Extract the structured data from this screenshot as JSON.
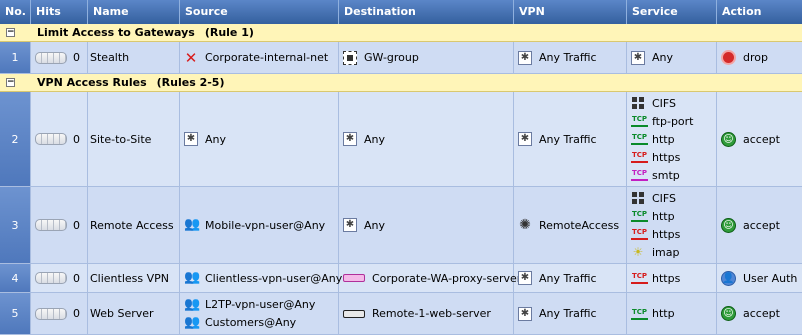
{
  "headers": {
    "no": "No.",
    "hits": "Hits",
    "name": "Name",
    "source": "Source",
    "destination": "Destination",
    "vpn": "VPN",
    "service": "Service",
    "action": "Action"
  },
  "sections": [
    {
      "toggle": "−",
      "title": "Limit Access to Gateways",
      "rules": "(Rule 1)"
    },
    {
      "toggle": "−",
      "title": "VPN Access Rules",
      "rules": "(Rules 2-5)"
    }
  ],
  "rules": [
    {
      "no": "1",
      "hits": "0",
      "name": "Stealth",
      "source": [
        {
          "icon": "x-icon",
          "text": "Corporate-internal-net"
        }
      ],
      "destination": [
        {
          "icon": "group-icon",
          "text": "GW-group"
        }
      ],
      "vpn": [
        {
          "icon": "any-icon",
          "text": "Any Traffic"
        }
      ],
      "service": [
        {
          "icon": "any-icon",
          "text": "Any"
        }
      ],
      "action": {
        "icon": "drop-icon",
        "text": "drop"
      }
    },
    {
      "no": "2",
      "hits": "0",
      "name": "Site-to-Site",
      "source": [
        {
          "icon": "any-icon",
          "text": "Any"
        }
      ],
      "destination": [
        {
          "icon": "any-icon",
          "text": "Any"
        }
      ],
      "vpn": [
        {
          "icon": "any-icon",
          "text": "Any Traffic"
        }
      ],
      "service": [
        {
          "icon": "service-group-icon",
          "text": "CIFS"
        },
        {
          "icon": "tcp-green-icon",
          "text": "ftp-port"
        },
        {
          "icon": "tcp-green-icon",
          "text": "http"
        },
        {
          "icon": "tcp-red-icon",
          "text": "https"
        },
        {
          "icon": "tcp-purple-icon",
          "text": "smtp"
        }
      ],
      "action": {
        "icon": "accept-icon",
        "text": "accept"
      }
    },
    {
      "no": "3",
      "hits": "0",
      "name": "Remote Access",
      "source": [
        {
          "icon": "user-group-icon",
          "text": "Mobile-vpn-user@Any"
        }
      ],
      "destination": [
        {
          "icon": "any-icon",
          "text": "Any"
        }
      ],
      "vpn": [
        {
          "icon": "vpn-community-icon",
          "text": "RemoteAccess"
        }
      ],
      "service": [
        {
          "icon": "service-group-icon",
          "text": "CIFS"
        },
        {
          "icon": "tcp-green-icon",
          "text": "http"
        },
        {
          "icon": "tcp-red-icon",
          "text": "https"
        },
        {
          "icon": "udp-icon",
          "text": "imap"
        }
      ],
      "action": {
        "icon": "accept-icon",
        "text": "accept"
      }
    },
    {
      "no": "4",
      "hits": "0",
      "name": "Clientless VPN",
      "source": [
        {
          "icon": "user-group-icon",
          "text": "Clientless-vpn-user@Any"
        }
      ],
      "destination": [
        {
          "icon": "gateway-icon",
          "text": "Corporate-WA-proxy-server"
        }
      ],
      "vpn": [
        {
          "icon": "any-icon",
          "text": "Any Traffic"
        }
      ],
      "service": [
        {
          "icon": "tcp-red-icon",
          "text": "https"
        }
      ],
      "action": {
        "icon": "user-auth-icon",
        "text": "User Auth"
      }
    },
    {
      "no": "5",
      "hits": "0",
      "name": "Web Server",
      "source": [
        {
          "icon": "user-group-icon",
          "text": "L2TP-vpn-user@Any"
        },
        {
          "icon": "user-group-icon",
          "text": "Customers@Any"
        }
      ],
      "destination": [
        {
          "icon": "server-icon",
          "text": "Remote-1-web-server"
        }
      ],
      "vpn": [
        {
          "icon": "any-icon",
          "text": "Any Traffic"
        }
      ],
      "service": [
        {
          "icon": "tcp-green-icon",
          "text": "http"
        }
      ],
      "action": {
        "icon": "accept-icon",
        "text": "accept"
      }
    }
  ]
}
